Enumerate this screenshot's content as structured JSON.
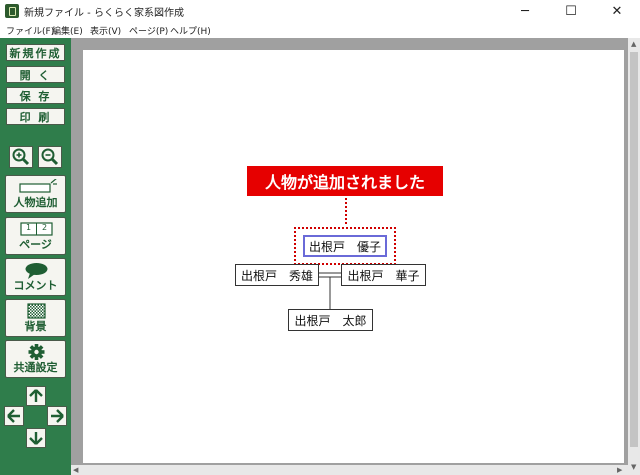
{
  "window": {
    "title": "新規ファイル - らくらく家系図作成",
    "minimize_glyph": "─",
    "maximize_glyph": "☐",
    "close_glyph": "✕"
  },
  "menu": [
    "ファイル(F)",
    "編集(E)",
    "表示(V)",
    "ページ(P)",
    "ヘルプ(H)"
  ],
  "toolbar": {
    "new_label": "新規作成",
    "open_label": "開 く",
    "save_label": "保 存",
    "print_label": "印 刷",
    "zoom_in_icon": "zoom-in-icon",
    "zoom_out_icon": "zoom-out-icon",
    "add_person_label": "人物追加",
    "page_label": "ページ",
    "page_icon_numbers": [
      "1",
      "2"
    ],
    "comment_label": "コメント",
    "background_label": "背景",
    "settings_label": "共通設定",
    "brand_color": "#2f7d4b"
  },
  "canvas": {
    "callout_text": "人物が追加されました",
    "callout_color": "#e60000",
    "persons": {
      "selected": "出根戸　優子",
      "father": "出根戸　秀雄",
      "mother": "出根戸　華子",
      "child": "出根戸　太郎"
    }
  }
}
